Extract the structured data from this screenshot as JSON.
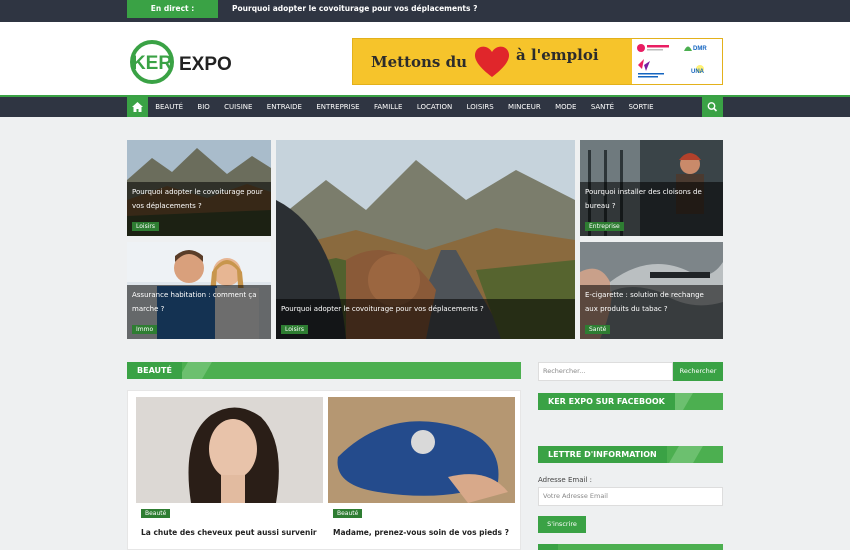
{
  "topbar": {
    "badge": "En direct :",
    "headline": "Pourquoi adopter le covoiturage pour vos déplacements ?"
  },
  "logo": {
    "mark": "KER",
    "name": "EXPO"
  },
  "ad": {
    "text_left": "Mettons du",
    "text_right": "à l'emploi",
    "sponsors": [
      "adessadomicile",
      "ADMR",
      "UNA"
    ]
  },
  "nav": {
    "items": [
      "Beauté",
      "Bio",
      "Cuisine",
      "Entraide",
      "Entreprise",
      "Famille",
      "Location",
      "Loisirs",
      "Minceur",
      "Mode",
      "Santé",
      "Sortie"
    ]
  },
  "hero": {
    "top_left": {
      "title": "Pourquoi adopter le covoiturage pour vos déplacements ?",
      "tag": "Loisirs"
    },
    "bottom_left": {
      "title": "Assurance habitation : comment ça marche ?",
      "tag": "Immo"
    },
    "center": {
      "title": "Pourquoi adopter le covoiturage pour vos déplacements ?",
      "tag": "Loisirs"
    },
    "top_right": {
      "title": "Pourquoi installer des cloisons de bureau ?",
      "tag": "Entreprise"
    },
    "bottom_right": {
      "title": "E-cigarette : solution de rechange aux produits du tabac ?",
      "tag": "Santé"
    }
  },
  "beauty": {
    "heading": "BEAUTÉ",
    "articles": [
      {
        "tag": "Beauté",
        "title": "La chute des cheveux peut aussi survenir"
      },
      {
        "tag": "Beauté",
        "title": "Madame, prenez-vous soin de vos pieds ?"
      }
    ]
  },
  "sidebar": {
    "search_placeholder": "Rechercher...",
    "search_button": "Rechercher",
    "facebook_heading": "KER EXPO SUR FACEBOOK",
    "newsletter_heading": "LETTRE D'INFORMATION",
    "email_label": "Adresse Email :",
    "email_placeholder": "Votre Adresse Email",
    "subscribe_button": "S'inscrire"
  },
  "colors": {
    "accent": "#3aa245",
    "dark": "#2f3542",
    "ad_yellow": "#f6c42b"
  }
}
